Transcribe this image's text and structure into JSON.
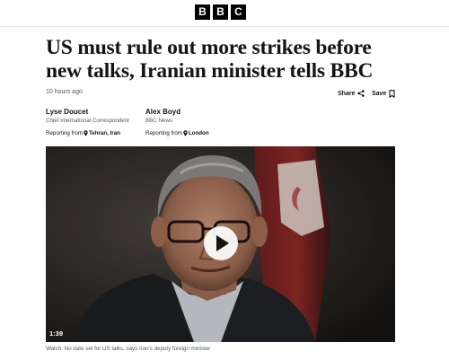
{
  "masthead": {
    "logo_letters": [
      "B",
      "B",
      "C"
    ]
  },
  "article": {
    "headline": "US must rule out more strikes before new talks, Iranian minister tells BBC",
    "timestamp": "10 hours ago",
    "actions": {
      "share_label": "Share",
      "save_label": "Save",
      "share_icon": "share-icon",
      "save_icon": "bookmark-icon"
    },
    "authors": [
      {
        "name": "Lyse Doucet",
        "role": "Chief International Correspondent",
        "reporting_prefix": "Reporting from",
        "location": "Tehran, Iran"
      },
      {
        "name": "Alex Boyd",
        "role": "BBC News",
        "reporting_prefix": "Reporting from",
        "location": "London"
      }
    ],
    "video": {
      "duration": "1:39",
      "caption": "Watch: No date set for US talks, says Iran's deputy foreign minister",
      "play_icon": "play-icon"
    }
  },
  "colors": {
    "text": "#141414",
    "muted": "#545658",
    "logo_bg": "#000000",
    "divider": "#e6e6e6"
  }
}
